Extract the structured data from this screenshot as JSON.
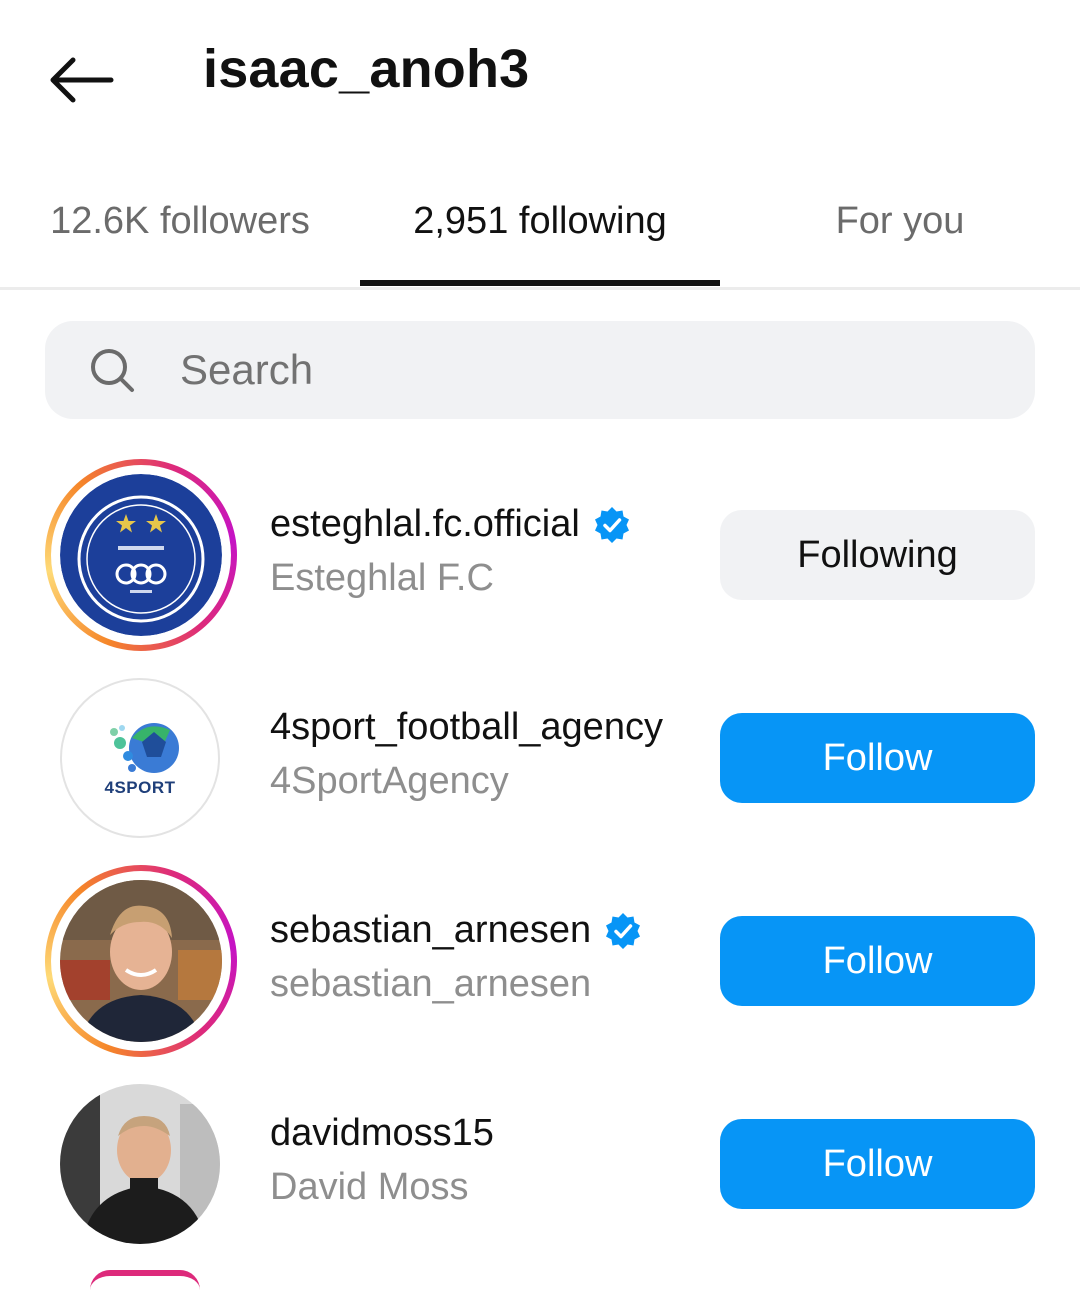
{
  "header": {
    "title": "isaac_anoh3",
    "back_icon": "arrow-left-icon"
  },
  "tabs": [
    {
      "label": "12.6K followers",
      "active": false
    },
    {
      "label": "2,951 following",
      "active": true
    },
    {
      "label": "For you",
      "active": false
    }
  ],
  "search": {
    "placeholder": "Search",
    "value": ""
  },
  "accounts": [
    {
      "username": "esteghlal.fc.official",
      "full_name": "Esteghlal F.C",
      "verified": true,
      "story_ring": true,
      "button": "Following"
    },
    {
      "username": "4sport_football_agency",
      "full_name": "4SportAgency",
      "verified": false,
      "story_ring": false,
      "button": "Follow",
      "avatar_text": "4SPORT"
    },
    {
      "username": "sebastian_arnesen",
      "full_name": "sebastian_arnesen",
      "verified": true,
      "story_ring": true,
      "button": "Follow"
    },
    {
      "username": "davidmoss15",
      "full_name": "David Moss",
      "verified": false,
      "story_ring": false,
      "button": "Follow"
    }
  ],
  "colors": {
    "follow_button": "#0795f6",
    "following_button": "#f1f2f4",
    "verified_badge": "#0795f6"
  }
}
